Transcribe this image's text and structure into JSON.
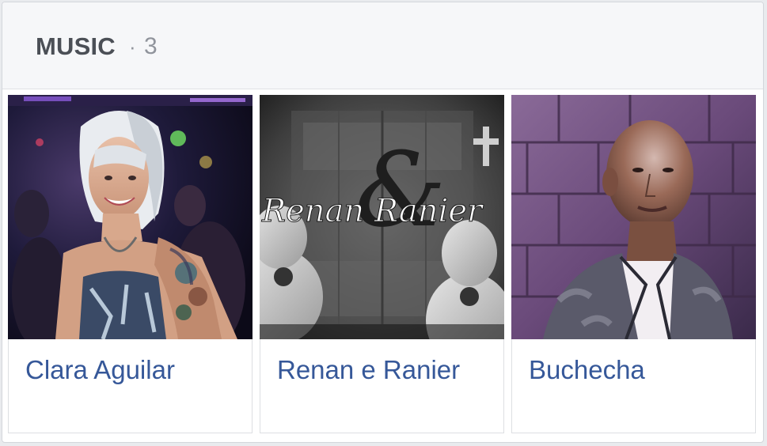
{
  "section": {
    "title": "MUSIC",
    "separator": "·",
    "count": "3"
  },
  "artists": [
    {
      "name": "Clara Aguilar",
      "image": "woman-with-tattoos-photo"
    },
    {
      "name": "Renan e Ranier",
      "image": "renan-ranier-logo-photo",
      "logo_text": "Renan Ranier",
      "logo_ampersand": "&"
    },
    {
      "name": "Buchecha",
      "image": "bald-man-portrait-photo"
    }
  ],
  "colors": {
    "link": "#365899",
    "header_text": "#4b4f56",
    "muted": "#90949c",
    "header_bg": "#f6f7f9"
  }
}
